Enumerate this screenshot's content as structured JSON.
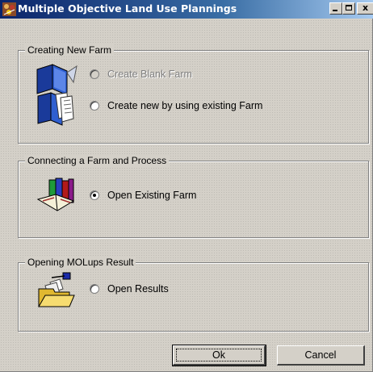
{
  "window": {
    "title": "Multiple Objective Land Use Plannings",
    "controls": {
      "minimize": "_",
      "maximize": "□",
      "close": "x"
    }
  },
  "groups": {
    "creating": {
      "legend": "Creating New Farm",
      "options": [
        {
          "label": "Create Blank Farm",
          "enabled": false,
          "selected": false,
          "icon": "open-book-icon"
        },
        {
          "label": "Create new by using existing Farm",
          "enabled": true,
          "selected": false,
          "icon": "book-pages-icon"
        }
      ]
    },
    "connecting": {
      "legend": "Connecting a Farm and Process",
      "options": [
        {
          "label": "Open Existing Farm",
          "enabled": true,
          "selected": true,
          "icon": "books-icon"
        }
      ]
    },
    "opening": {
      "legend": "Opening MOLups Result",
      "options": [
        {
          "label": "Open Results",
          "enabled": true,
          "selected": false,
          "icon": "open-folder-icon"
        }
      ]
    }
  },
  "buttons": {
    "ok": "Ok",
    "cancel": "Cancel"
  },
  "colors": {
    "titlebar_start": "#0a246a",
    "titlebar_end": "#a6caf0",
    "face": "#d4d0c8"
  }
}
